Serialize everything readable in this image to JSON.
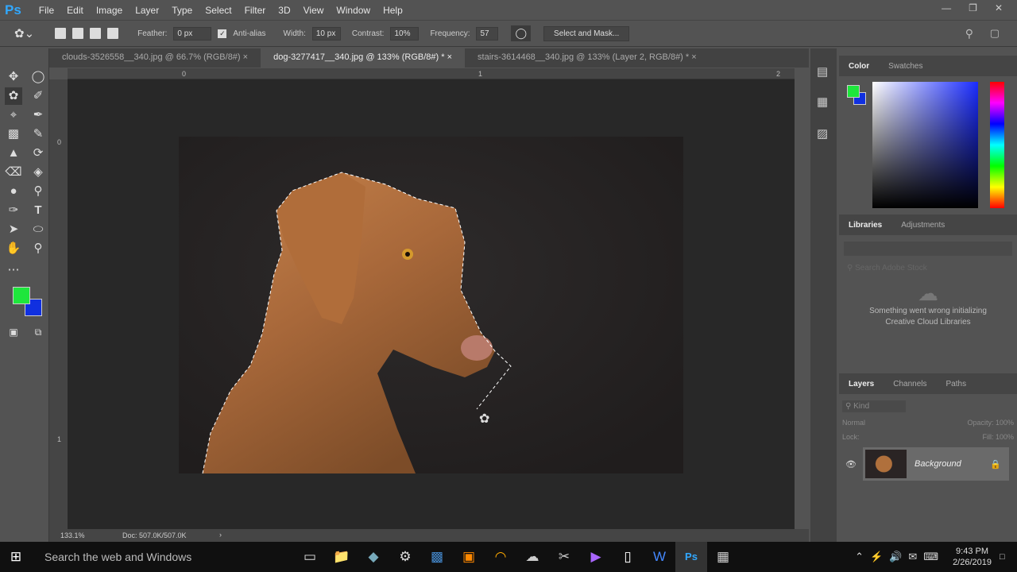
{
  "app": {
    "logo": "Ps"
  },
  "menu": [
    "File",
    "Edit",
    "Image",
    "Layer",
    "Type",
    "Select",
    "Filter",
    "3D",
    "View",
    "Window",
    "Help"
  ],
  "options": {
    "feather_label": "Feather:",
    "feather": "0 px",
    "antialias_label": "Anti-alias",
    "antialias": true,
    "width_label": "Width:",
    "width": "10 px",
    "contrast_label": "Contrast:",
    "contrast": "10%",
    "frequency_label": "Frequency:",
    "frequency": "57",
    "select_mask": "Select and Mask..."
  },
  "tabs": [
    {
      "label": "clouds-3526558__340.jpg @ 66.7% (RGB/8#)",
      "active": false
    },
    {
      "label": "dog-3277417__340.jpg @ 133% (RGB/8#) *",
      "active": true
    },
    {
      "label": "stairs-3614468__340.jpg @ 133% (Layer 2, RGB/8#) *",
      "active": false
    }
  ],
  "ruler": {
    "h": [
      "0",
      "1",
      "2"
    ],
    "v": [
      "0",
      "1"
    ]
  },
  "colors": {
    "foreground": "#1ee63c",
    "background": "#1030e0"
  },
  "status": {
    "zoom": "133.1%",
    "doc": "Doc: 507.0K/507.0K"
  },
  "color_panel": {
    "tabs": [
      "Color",
      "Swatches"
    ]
  },
  "libraries": {
    "tabs": [
      "Libraries",
      "Adjustments"
    ],
    "search_placeholder": "Search Adobe Stock",
    "error": "Something went wrong initializing Creative Cloud Libraries"
  },
  "layers": {
    "tabs": [
      "Layers",
      "Channels",
      "Paths"
    ],
    "kind": "Kind",
    "blend": "Normal",
    "opacity_label": "Opacity:",
    "opacity": "100%",
    "lock_label": "Lock:",
    "fill_label": "Fill:",
    "fill": "100%",
    "items": [
      {
        "name": "Background",
        "visible": true,
        "locked": true
      }
    ]
  },
  "taskbar": {
    "search": "Search the web and Windows",
    "time": "9:43 PM",
    "date": "2/26/2019"
  }
}
